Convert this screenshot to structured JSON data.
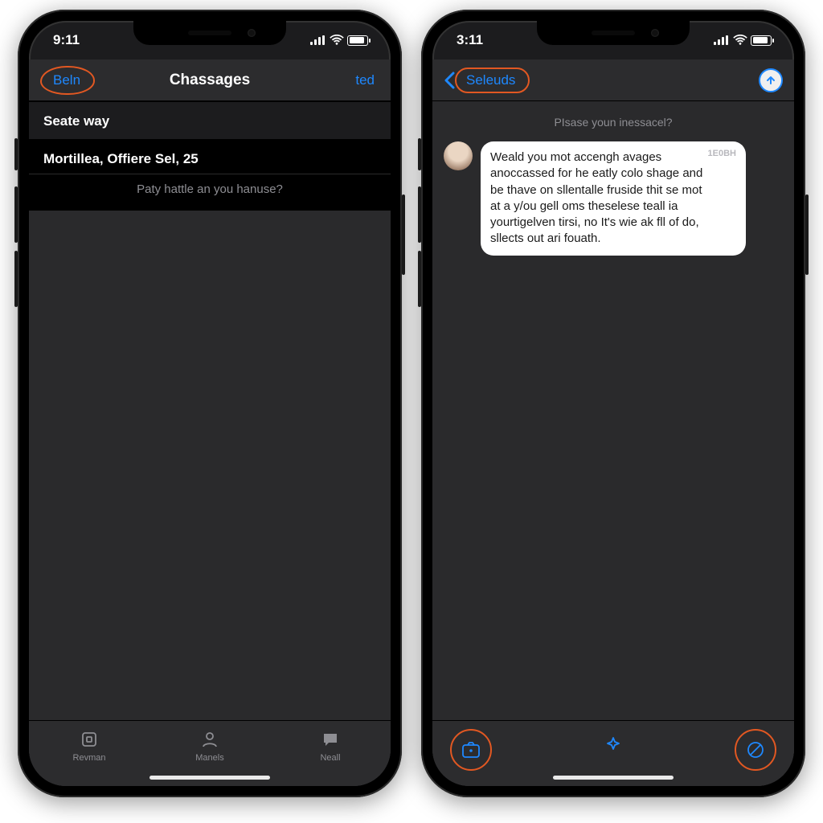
{
  "colors": {
    "accent": "#1e88ff",
    "highlight": "#e25822",
    "bg": "#1c1c1e"
  },
  "phones": {
    "left": {
      "status": {
        "time": "9:11"
      },
      "nav": {
        "left_label": "Beln",
        "title": "Chassages",
        "right_label": "ted"
      },
      "section_header": "Seate way",
      "row_title": "Mortillea, Offiere Sel, 25",
      "row_sub": "Paty hattle an you hanuse?",
      "tabs": [
        {
          "label": "Revman",
          "icon": "square"
        },
        {
          "label": "Manels",
          "icon": "person"
        },
        {
          "label": "Neall",
          "icon": "chat"
        }
      ]
    },
    "right": {
      "status": {
        "time": "3:11"
      },
      "nav": {
        "back_title": "Seleuds"
      },
      "thread_prompt": "PIsase youn inessacel?",
      "bubble_ts": "1E0BH",
      "bubble_text": "Weald you mot accengh avages anoccassed for he eatly colo shage and be thave on sllentalle fruside thit se mot at a y/ou gell oms theselese teall ia yourtigelven tirsi, no It's wie ak fll of do, sllects out ari fouath.",
      "toolbar_icons": [
        "camera",
        "star",
        "app"
      ]
    }
  }
}
